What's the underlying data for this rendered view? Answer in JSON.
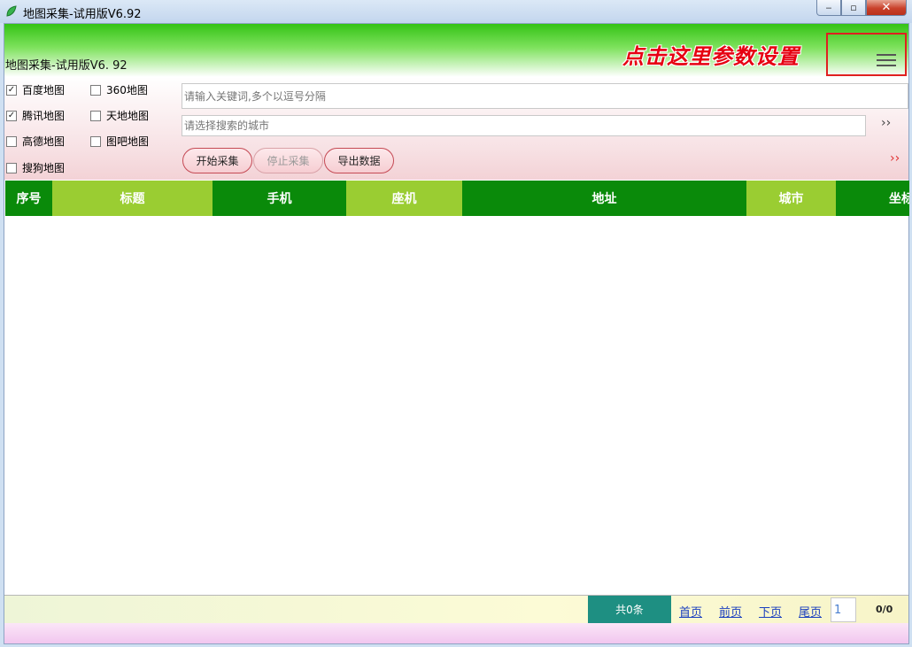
{
  "window": {
    "title": "地图采集-试用版V6.92",
    "minimize": "‒",
    "restore": "▫",
    "close": "✕"
  },
  "header": {
    "app_title": "地图采集-试用版V6. 92",
    "hint": "点击这里参数设置"
  },
  "maps": [
    {
      "label": "百度地图",
      "checked": true
    },
    {
      "label": "360地图",
      "checked": false
    },
    {
      "label": "腾讯地图",
      "checked": true
    },
    {
      "label": "天地地图",
      "checked": false
    },
    {
      "label": "高德地图",
      "checked": false
    },
    {
      "label": "图吧地图",
      "checked": false
    },
    {
      "label": "搜狗地图",
      "checked": false
    }
  ],
  "search": {
    "keyword_placeholder": "请输入关键词,多个以逗号分隔",
    "city_placeholder": "请选择搜索的城市",
    "arrow": "››",
    "more_arrow": "››"
  },
  "buttons": {
    "start": "开始采集",
    "stop": "停止采集",
    "export": "导出数据"
  },
  "table": {
    "columns": [
      "序号",
      "标题",
      "手机",
      "座机",
      "地址",
      "城市",
      "坐标"
    ]
  },
  "pager": {
    "total": "共0条",
    "first": "首页",
    "prev": "前页",
    "next": "下页",
    "last": "尾页",
    "page": "1",
    "count": "0/0"
  }
}
